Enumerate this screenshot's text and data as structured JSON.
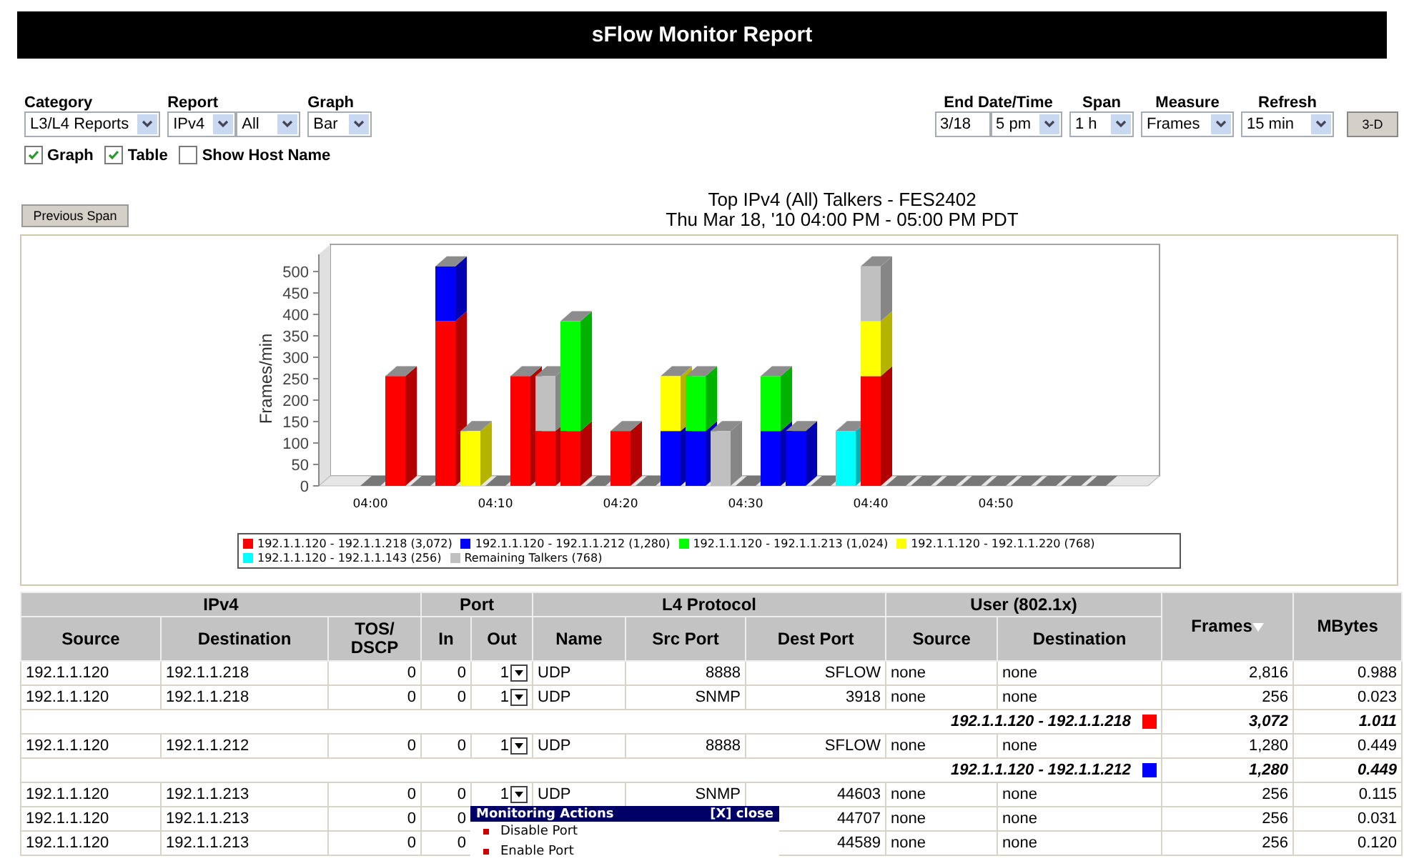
{
  "header": {
    "title": "sFlow Monitor Report"
  },
  "filters_left": [
    {
      "label": "Category",
      "controls": [
        {
          "kind": "select",
          "value": "L3/L4 Reports"
        }
      ]
    },
    {
      "label": "Report",
      "controls": [
        {
          "kind": "select",
          "value": "IPv4"
        },
        {
          "kind": "select",
          "value": "All"
        }
      ]
    },
    {
      "label": "Graph",
      "controls": [
        {
          "kind": "select",
          "value": "Bar"
        }
      ]
    }
  ],
  "filters_right": [
    {
      "label": "End Date/Time",
      "controls": [
        {
          "kind": "input",
          "value": "3/18"
        },
        {
          "kind": "select",
          "value": "5 pm"
        }
      ]
    },
    {
      "label": "Span",
      "controls": [
        {
          "kind": "select",
          "value": "1 h"
        }
      ]
    },
    {
      "label": "Measure",
      "controls": [
        {
          "kind": "select",
          "value": "Frames"
        }
      ]
    },
    {
      "label": "Refresh",
      "controls": [
        {
          "kind": "select",
          "value": "15 min"
        }
      ]
    }
  ],
  "style_button": "3-D",
  "options": [
    {
      "label": "Graph",
      "checked": true
    },
    {
      "label": "Table",
      "checked": true
    },
    {
      "label": "Show Host Name",
      "checked": false
    }
  ],
  "previous_span_button": "Previous Span",
  "chart": {
    "title_lines": [
      "Top IPv4 (All) Talkers - FES2402",
      "Thu Mar 18, '10 04:00 PM - 05:00 PM PDT"
    ],
    "chart_data": {
      "type": "bar",
      "stacked": true,
      "ylabel": "Frames/min",
      "ylim": [
        0,
        540
      ],
      "yticks": [
        0,
        50,
        100,
        150,
        200,
        250,
        300,
        350,
        400,
        450,
        500
      ],
      "categories": [
        "04:00",
        null,
        null,
        null,
        null,
        "04:10",
        null,
        null,
        null,
        null,
        "04:20",
        null,
        null,
        null,
        null,
        "04:30",
        null,
        null,
        null,
        null,
        "04:40",
        null,
        null,
        null,
        null,
        "04:50",
        null,
        null,
        null,
        null
      ],
      "series": [
        {
          "name": "192.1.1.120 - 192.1.1.218 (3,072)",
          "color": "#ff0000",
          "values": [
            0,
            256,
            0,
            384,
            0,
            0,
            256,
            128,
            128,
            0,
            128,
            0,
            0,
            0,
            0,
            0,
            0,
            0,
            0,
            0,
            256,
            0,
            0,
            0,
            0,
            0,
            0,
            0,
            0,
            0
          ]
        },
        {
          "name": "192.1.1.120 - 192.1.1.212 (1,280)",
          "color": "#0000ff",
          "values": [
            0,
            0,
            0,
            128,
            0,
            0,
            0,
            0,
            0,
            0,
            0,
            0,
            128,
            128,
            0,
            0,
            128,
            128,
            0,
            0,
            0,
            0,
            0,
            0,
            0,
            0,
            0,
            0,
            0,
            0
          ]
        },
        {
          "name": "192.1.1.120 - 192.1.1.213 (1,024)",
          "color": "#00ff00",
          "values": [
            0,
            0,
            0,
            0,
            0,
            0,
            0,
            0,
            256,
            0,
            0,
            0,
            0,
            128,
            0,
            0,
            128,
            0,
            0,
            0,
            0,
            0,
            0,
            0,
            0,
            0,
            0,
            0,
            0,
            0
          ]
        },
        {
          "name": "192.1.1.120 - 192.1.1.220 (768)",
          "color": "#ffff00",
          "values": [
            0,
            0,
            0,
            0,
            128,
            0,
            0,
            0,
            0,
            0,
            0,
            0,
            128,
            0,
            0,
            0,
            0,
            0,
            0,
            0,
            128,
            0,
            0,
            0,
            0,
            0,
            0,
            0,
            0,
            0
          ]
        },
        {
          "name": "192.1.1.120 - 192.1.1.143 (256)",
          "color": "#00ffff",
          "values": [
            0,
            0,
            0,
            0,
            0,
            0,
            0,
            0,
            0,
            0,
            0,
            0,
            0,
            0,
            0,
            0,
            0,
            0,
            0,
            128,
            0,
            0,
            0,
            0,
            0,
            0,
            0,
            0,
            0,
            0
          ]
        },
        {
          "name": "Remaining Talkers (768)",
          "color": "#c0c0c0",
          "values": [
            0,
            0,
            0,
            0,
            0,
            0,
            0,
            128,
            0,
            0,
            0,
            0,
            0,
            0,
            128,
            0,
            0,
            0,
            0,
            0,
            128,
            0,
            0,
            0,
            0,
            0,
            0,
            0,
            0,
            0
          ]
        }
      ]
    }
  },
  "table": {
    "group_headers": [
      {
        "label": "IPv4",
        "columns": [
          "Source",
          "Destination",
          "TOS/ DSCP"
        ]
      },
      {
        "label": "Port",
        "columns": [
          "In",
          "Out"
        ]
      },
      {
        "label": "L4 Protocol",
        "columns": [
          "Name",
          "Src Port",
          "Dest Port"
        ]
      },
      {
        "label": "User (802.1x)",
        "columns": [
          "Source",
          "Destination"
        ]
      }
    ],
    "total_headers": [
      {
        "label": "Frames",
        "sorted": true
      },
      {
        "label": "MBytes",
        "sorted": false
      }
    ],
    "rows": [
      {
        "kind": "flow",
        "source": "192.1.1.120",
        "destination": "192.1.1.218",
        "tos": "0",
        "in": "0",
        "out": "1",
        "name": "UDP",
        "src_port": "8888",
        "dest_port": "SFLOW",
        "user_source": "none",
        "user_destination": "none",
        "frames": "2,816",
        "mbytes": "0.988"
      },
      {
        "kind": "flow",
        "source": "192.1.1.120",
        "destination": "192.1.1.218",
        "tos": "0",
        "in": "0",
        "out": "1",
        "name": "UDP",
        "src_port": "SNMP",
        "dest_port": "3918",
        "user_source": "none",
        "user_destination": "none",
        "frames": "256",
        "mbytes": "0.023"
      },
      {
        "kind": "subtotal",
        "label": "192.1.1.120 - 192.1.1.218",
        "color": "#ff0000",
        "frames": "3,072",
        "mbytes": "1.011"
      },
      {
        "kind": "flow",
        "source": "192.1.1.120",
        "destination": "192.1.1.212",
        "tos": "0",
        "in": "0",
        "out": "1",
        "name": "UDP",
        "src_port": "8888",
        "dest_port": "SFLOW",
        "user_source": "none",
        "user_destination": "none",
        "frames": "1,280",
        "mbytes": "0.449"
      },
      {
        "kind": "subtotal",
        "label": "192.1.1.120 - 192.1.1.212",
        "color": "#0000ff",
        "frames": "1,280",
        "mbytes": "0.449"
      },
      {
        "kind": "flow",
        "source": "192.1.1.120",
        "destination": "192.1.1.213",
        "tos": "0",
        "in": "0",
        "out": "1",
        "name": "UDP",
        "src_port": "SNMP",
        "dest_port": "44603",
        "user_source": "none",
        "user_destination": "none",
        "frames": "256",
        "mbytes": "0.115"
      },
      {
        "kind": "flow",
        "source": "192.1.1.120",
        "destination": "192.1.1.213",
        "tos": "0",
        "in": "0",
        "dest_port": "44707",
        "user_source": "none",
        "user_destination": "none",
        "frames": "256",
        "mbytes": "0.031"
      },
      {
        "kind": "flow",
        "source": "192.1.1.120",
        "destination": "192.1.1.213",
        "tos": "0",
        "in": "0",
        "dest_port": "44589",
        "user_source": "none",
        "user_destination": "none",
        "frames": "256",
        "mbytes": "0.120"
      }
    ]
  },
  "popup": {
    "title": "Monitoring Actions",
    "close": "[X] close",
    "items": [
      "Disable Port",
      "Enable Port"
    ]
  }
}
